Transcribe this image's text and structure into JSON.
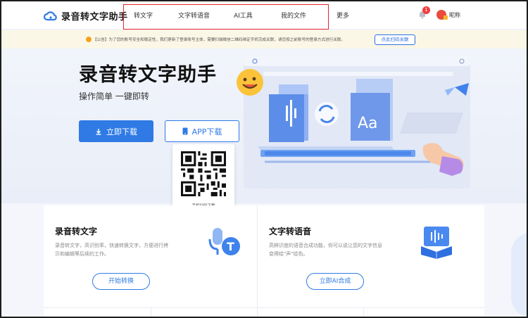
{
  "app": {
    "name": "录音转文字助手"
  },
  "nav": {
    "items": [
      {
        "label": "转文字"
      },
      {
        "label": "文字转语音"
      },
      {
        "label": "AI工具"
      },
      {
        "label": "我的文件"
      }
    ],
    "more": "更多"
  },
  "user": {
    "notification_count": "1",
    "nickname": "昵称"
  },
  "notice": {
    "text": "【公告】为了您的账号安全和稳定性，我们更新了登录账号主体，需要扫描微信二维码绑定手机完成关联，请您按之前账号的登录方式进行关联。",
    "button": "点此扫码关联"
  },
  "hero": {
    "title": "录音转文字助手",
    "subtitle": "操作简单 一键即转",
    "download_button": "立即下载",
    "app_download_button": "APP下载",
    "qr_label": "手机扫码下载"
  },
  "cards": [
    {
      "title": "录音转文字",
      "desc_line1": "录音转文字，高识别率，快速转换文字，方便进行拷",
      "desc_line2": "贝和编辑等后续的工作。",
      "button": "开始转换",
      "icon": "mic-text-icon"
    },
    {
      "title": "文字转语音",
      "desc_line1": "高辨识度的语音合成功能，你可以说让您的文字信息",
      "desc_line2": "变得绘\"声\"绘色。",
      "button": "立即AI合成",
      "icon": "book-audio-icon"
    }
  ],
  "colors": {
    "primary": "#2f7ae5",
    "nav_highlight": "#e5242b",
    "badge": "#f53c3c",
    "notice_bg": "#fbf7e6"
  }
}
